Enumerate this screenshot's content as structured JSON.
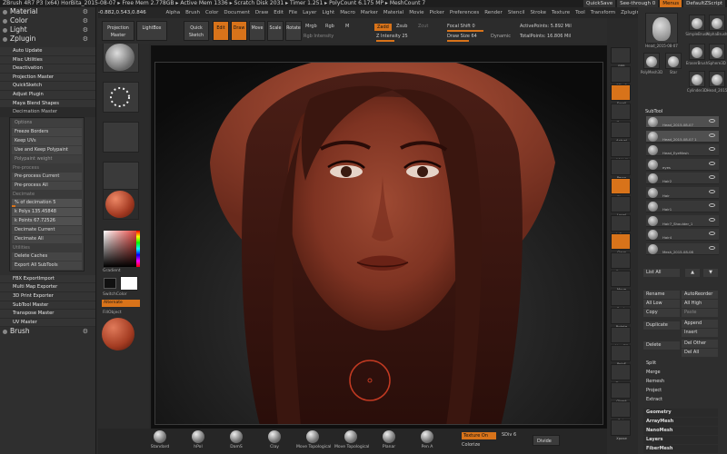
{
  "title_bar": {
    "text": "ZBrush 4R7 P3 (x64)     HorBita_2015-08-07     ▸ Free Mem 2.778GB ▸ Active Mem 1336 ▸ Scratch Disk 2031 ▸ Timer 1.251 ▸ PolyCount 6.175 MP ▸ MeshCount 7",
    "quicksave": "QuickSave",
    "see_through": "See-through 0",
    "menus_btn": "Menus",
    "default_script": "DefaultZScript"
  },
  "menu_bar": [
    "Alpha",
    "Brush",
    "Color",
    "Document",
    "Draw",
    "Edit",
    "File",
    "Layer",
    "Light",
    "Macro",
    "Marker",
    "Material",
    "Movie",
    "Picker",
    "Preferences",
    "Render",
    "Stencil",
    "Stroke",
    "Texture",
    "Tool",
    "Transform",
    "Zplugin",
    "Zscript"
  ],
  "coords": "-0.882,0.543,0.846",
  "left_panel": {
    "headers": [
      {
        "label": "Material",
        "icon": "gear-icon"
      },
      {
        "label": "Color",
        "icon": "gear-icon"
      },
      {
        "label": "Light",
        "icon": "gear-icon"
      },
      {
        "label": "Zplugin",
        "icon": "gear-icon"
      }
    ],
    "plugins": [
      "Auto Update",
      "Misc Utilities",
      "Deactivation",
      "Projection Master",
      "QuickSketch",
      "Adjust Plugin",
      "Maya Blend Shapes"
    ],
    "decimation": {
      "title": "Decimation Master",
      "items": [
        "Options",
        "Freeze Borders",
        "Keep UVs",
        "Use and Keep Polypaint",
        "Polypaint weight"
      ],
      "preprocess_label": "Pre-process",
      "preprocess_current": "Pre-process Current",
      "preprocess_all": "Pre-process All",
      "decimate_label": "Decimate",
      "pct_decimation": "% of decimation 5",
      "k_polys": "k Polys 135.45848",
      "k_points": "k Points 67.72526",
      "pct_value": 5,
      "decimate_current": "Decimate Current",
      "decimate_all": "Decimate All",
      "utilities": "Utilities",
      "delete_caches": "Delete Caches",
      "export_subtools": "Export All SubTools"
    },
    "plugins2": [
      "FBX ExportImport",
      "Multi Map Exporter",
      "3D Print Exporter",
      "SubTool Master",
      "Transpose Master",
      "UV Master"
    ],
    "brush_header": "Brush"
  },
  "shelf": {
    "tiles": [
      "Clay",
      "MatCap Red",
      "Gradient",
      "SwitchColor",
      "Alternate",
      "FillObject"
    ],
    "alternate": "Alternate",
    "gradient": "Gradient",
    "switch_color": "SwitchColor",
    "fill_object": "FillObject"
  },
  "top_tools": {
    "projection_master": "Projection Master",
    "lightbox": "LightBox",
    "quick_sketch": "Quick Sketch",
    "edit": "Edit",
    "draw": "Draw",
    "move": "Move",
    "scale": "Scale",
    "rotate": "Rotate",
    "mrgb": "Mrgb",
    "rgb": "Rgb",
    "m": "M",
    "zadd": "Zadd",
    "zsub": "Zsub",
    "zcut": "Zcut",
    "rgb_intensity": "Rgb Intensity",
    "z_intensity": "Z Intensity 25",
    "focal_shift": "Focal Shift 0",
    "draw_size": "Draw Size 64",
    "dynamic": "Dynamic",
    "active_points": "ActivePoints: 5.892 Mil",
    "total_points": "TotalPoints: 16.806 Mil"
  },
  "right_vert": [
    "BPR",
    "SPix 3",
    "Scroll",
    "Zoom",
    "Actual",
    "AAHalf",
    "Persp",
    "Floor",
    "Local",
    "L.Sym",
    "Gxyz",
    "Frame",
    "Move",
    "Scale",
    "Rotate",
    "Line Fill",
    "PolyF",
    "Transp",
    "Ghost",
    "Solo",
    "Xpose"
  ],
  "right_panel": {
    "tools": [
      "Head_2015-08-07",
      "SimpleBrush",
      "AlphaBrush",
      "EraserBrush",
      "Sphere3D",
      "PolyMesh3D",
      "Star",
      "Cylinder3D",
      "Head_2015"
    ],
    "subtool_header": "SubTool",
    "subtools": [
      "Head_2015-08-07",
      "Head_2015-08-07 1",
      "Head_EyeMesh",
      "eyes",
      "Hair2",
      "Hair",
      "Hair1",
      "Hair7_Shoulder_1",
      "Hair4",
      "Mesh_2015-08-08"
    ],
    "list_all": "List All",
    "rename": "Rename",
    "auto_reorder": "AutoReorder",
    "all_low": "All Low",
    "all_high": "All High",
    "copy": "Copy",
    "paste": "Paste",
    "duplicate": "Duplicate",
    "append": "Append",
    "insert": "Insert",
    "delete": "Delete",
    "del_other": "Del Other",
    "del_all": "Del All",
    "split": "Split",
    "merge": "Merge",
    "remesh": "Remesh",
    "project": "Project",
    "extract": "Extract",
    "menus2": [
      "Geometry",
      "ArrayMesh",
      "NanoMesh",
      "Layers",
      "FiberMesh"
    ]
  },
  "bottom_bar": {
    "brushes": [
      "Standard",
      "hPol",
      "DamS",
      "Clay",
      "Move Topological",
      "Move Topological",
      "Planar",
      "Pen A"
    ],
    "texture_on": "Texture On",
    "colorize": "Colorize",
    "sdiv": "SDiv 6",
    "divide": "Divide"
  },
  "colors": {
    "accent": "#d8731a",
    "skin": "#8a3a28",
    "bg": "#2e2e2e"
  }
}
